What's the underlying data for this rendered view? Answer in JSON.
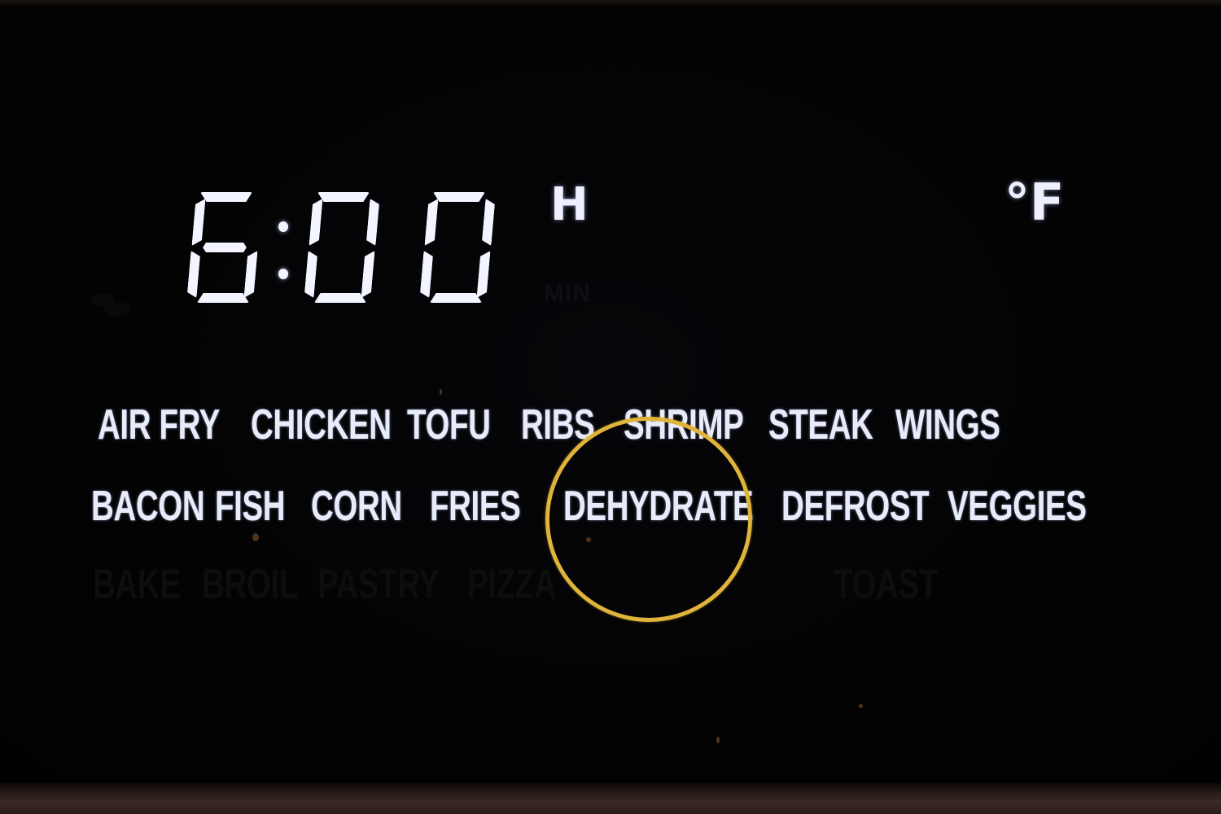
{
  "display": {
    "time": {
      "hours": "6",
      "minutes_tens": "0",
      "minutes_ones": "0",
      "separator": ":",
      "full_text": "6:00"
    },
    "unit_hours_label": "H",
    "unit_minutes_label": "MIN",
    "temperature_unit_label": "°F",
    "fan_icon": "fan-icon"
  },
  "menu": {
    "row1": [
      {
        "label": "AIR FRY",
        "lit": true
      },
      {
        "label": "CHICKEN",
        "lit": true
      },
      {
        "label": "TOFU",
        "lit": true
      },
      {
        "label": "RIBS",
        "lit": true
      },
      {
        "label": "SHRIMP",
        "lit": true
      },
      {
        "label": "STEAK",
        "lit": true
      },
      {
        "label": "WINGS",
        "lit": true
      }
    ],
    "row2": [
      {
        "label": "BACON",
        "lit": true
      },
      {
        "label": "FISH",
        "lit": true
      },
      {
        "label": "CORN",
        "lit": true
      },
      {
        "label": "FRIES",
        "lit": true
      },
      {
        "label": "DEHYDRATE",
        "lit": true,
        "selected": true
      },
      {
        "label": "DEFROST",
        "lit": true
      },
      {
        "label": "VEGGIES",
        "lit": true
      }
    ],
    "row3": [
      {
        "label": "BAKE",
        "lit": false
      },
      {
        "label": "BROIL",
        "lit": false
      },
      {
        "label": "PASTRY",
        "lit": false
      },
      {
        "label": "PIZZA",
        "lit": false
      },
      {
        "label": "TOAST",
        "lit": false
      }
    ],
    "selected_program": "DEHYDRATE"
  },
  "colors": {
    "lit_text": "#e8ecfa",
    "background": "#020203",
    "highlight_ring": "#e0b43a"
  }
}
